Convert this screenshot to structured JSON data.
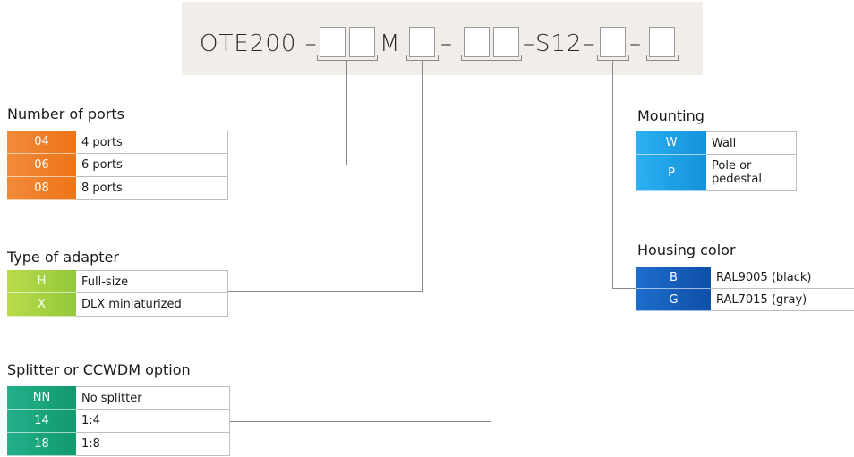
{
  "code": {
    "prefix": "OTE200 –",
    "m": "M",
    "dash1": "–",
    "s12": "–S12–",
    "dash2": "–"
  },
  "sections": {
    "ports": {
      "title": "Number of ports",
      "color": "#f07a22",
      "rows": [
        {
          "code": "04",
          "label": "4 ports"
        },
        {
          "code": "06",
          "label": "6 ports"
        },
        {
          "code": "08",
          "label": "8 ports"
        }
      ]
    },
    "adapter": {
      "title": "Type of adapter",
      "color": "#9ccf3c",
      "rows": [
        {
          "code": "H",
          "label": "Full-size"
        },
        {
          "code": "X",
          "label": "DLX miniaturized"
        }
      ]
    },
    "splitter": {
      "title": "Splitter or CCWDM option",
      "color": "#1aa37a",
      "rows": [
        {
          "code": "NN",
          "label": "No splitter"
        },
        {
          "code": "14",
          "label": "1:4"
        },
        {
          "code": "18",
          "label": "1:8"
        }
      ]
    },
    "mounting": {
      "title": "Mounting",
      "color": "#1ea0e6",
      "rows": [
        {
          "code": "W",
          "label": "Wall"
        },
        {
          "code": "P",
          "label": "Pole or pedestal"
        }
      ]
    },
    "housing": {
      "title": "Housing color",
      "color": "#1560c0",
      "rows": [
        {
          "code": "B",
          "label": "RAL9005 (black)"
        },
        {
          "code": "G",
          "label": "RAL7015 (gray)"
        }
      ]
    }
  }
}
